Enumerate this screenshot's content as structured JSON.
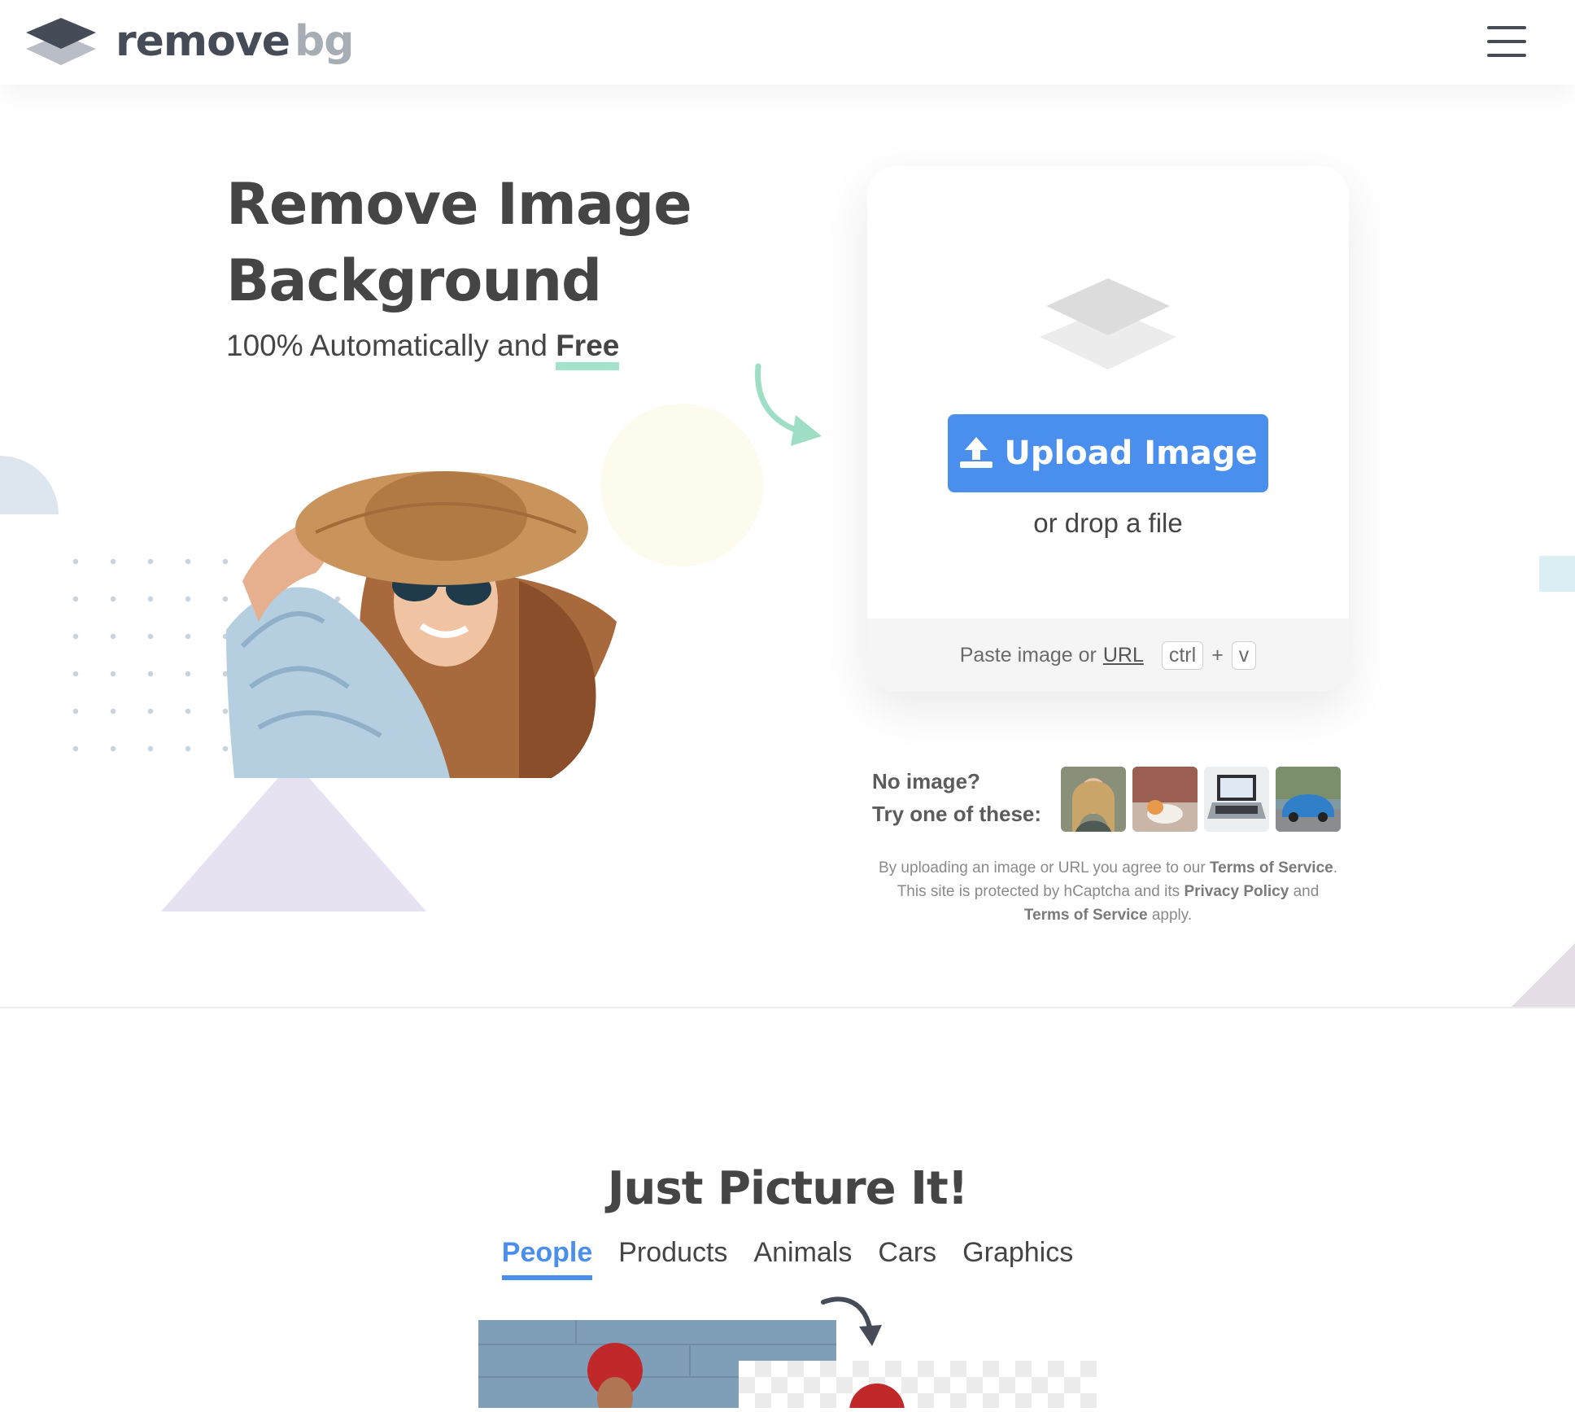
{
  "header": {
    "logo_main": "remove",
    "logo_suffix": "bg",
    "menu_icon": "hamburger-menu-icon"
  },
  "hero": {
    "title_line1": "Remove Image",
    "title_line2": "Background",
    "subtitle_prefix": "100% Automatically and",
    "subtitle_emphasis": "Free"
  },
  "upload_card": {
    "button_label": "Upload Image",
    "drop_text": "or drop a file",
    "paste_text": "Paste image or",
    "paste_link": "URL",
    "key_ctrl": "ctrl",
    "key_plus": "+",
    "key_v": "v"
  },
  "samples": {
    "line1": "No image?",
    "line2": "Try one of these:",
    "items": [
      "woman-portrait",
      "cat",
      "laptop",
      "blue-car"
    ]
  },
  "legal": {
    "t1": "By uploading an image or URL you agree to our",
    "tos1": "Terms of Service",
    "t2": ".",
    "t3": "This site is protected by hCaptcha and its",
    "privacy": "Privacy Policy",
    "t4": "and",
    "tos2": "Terms of Service",
    "t5": "apply."
  },
  "section": {
    "title": "Just Picture It!",
    "tabs": [
      "People",
      "Products",
      "Animals",
      "Cars",
      "Graphics"
    ],
    "active_tab": "People"
  },
  "colors": {
    "accent": "#4a8fee",
    "text": "#454545",
    "green_highlight": "#a4e3cb"
  }
}
